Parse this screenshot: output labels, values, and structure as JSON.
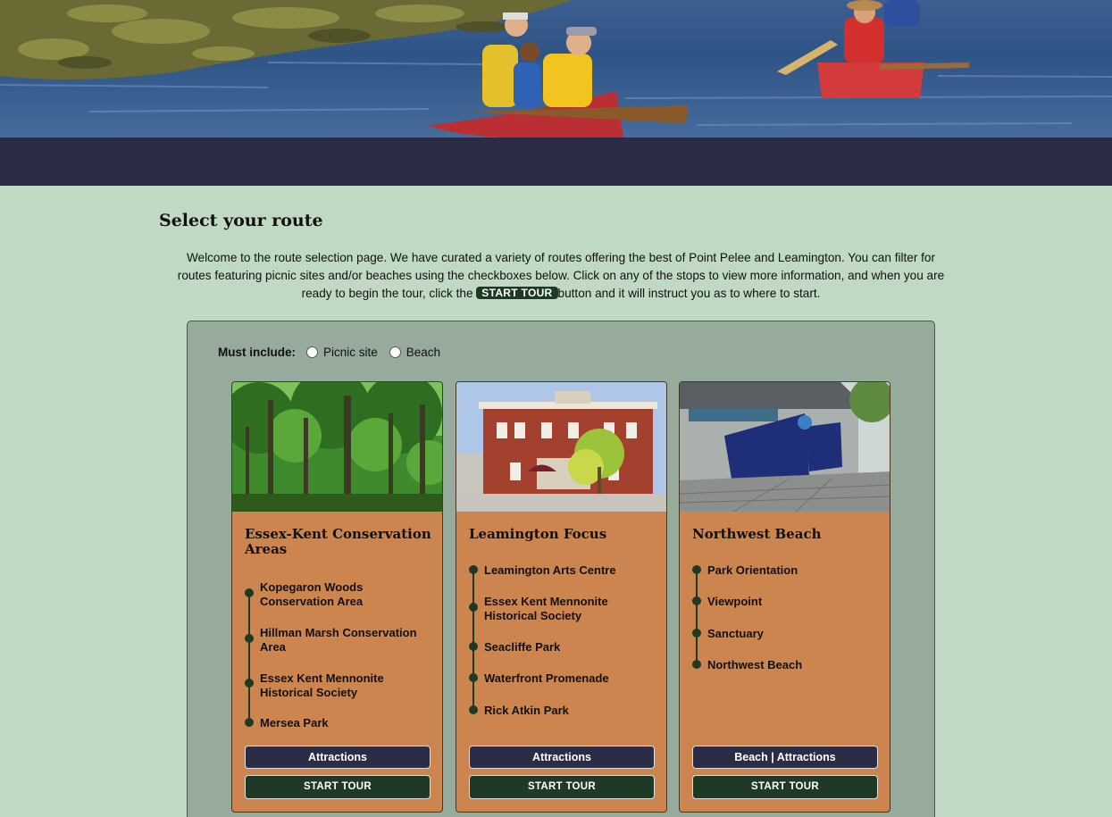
{
  "page": {
    "title": "Select your route",
    "intro_before": "Welcome to the route selection page. We have curated a variety of routes offering the best of Point Pelee and Leamington. You can filter for routes featuring picnic sites and/or beaches using the checkboxes below. Click on any of the stops to view more information, and when you are ready to begin the tour, click the",
    "intro_button": "START TOUR",
    "intro_after": "button and it will instruct you as to where to start."
  },
  "filters": {
    "label": "Must include:",
    "options": [
      {
        "label": "Picnic site",
        "checked": false
      },
      {
        "label": "Beach",
        "checked": false
      }
    ]
  },
  "routes": [
    {
      "title": "Essex-Kent Conservation Areas",
      "image": "forest-photo",
      "stops": [
        "Kopegaron Woods Conservation Area",
        "Hillman Marsh Conservation Area",
        "Essex Kent Mennonite Historical Society",
        "Mersea Park"
      ],
      "category_button": "Attractions",
      "start_button": "START TOUR"
    },
    {
      "title": "Leamington Focus",
      "image": "arts-centre-building-photo",
      "stops": [
        "Leamington Arts Centre",
        "Essex Kent Mennonite Historical Society",
        "Seacliffe Park",
        "Waterfront Promenade",
        "Rick Atkin Park"
      ],
      "category_button": "Attractions",
      "start_button": "START TOUR"
    },
    {
      "title": "Northwest Beach",
      "image": "welcome-sign-photo",
      "stops": [
        "Park Orientation",
        "Viewpoint",
        "Sanctuary",
        "Northwest Beach"
      ],
      "category_button": "Beach | Attractions",
      "start_button": "START TOUR"
    }
  ],
  "colors": {
    "background": "#c0d9c2",
    "navbar": "#2b2c45",
    "panel": "#96ab9b",
    "card": "#cd8550",
    "accent_dark_green": "#1f3a24"
  }
}
